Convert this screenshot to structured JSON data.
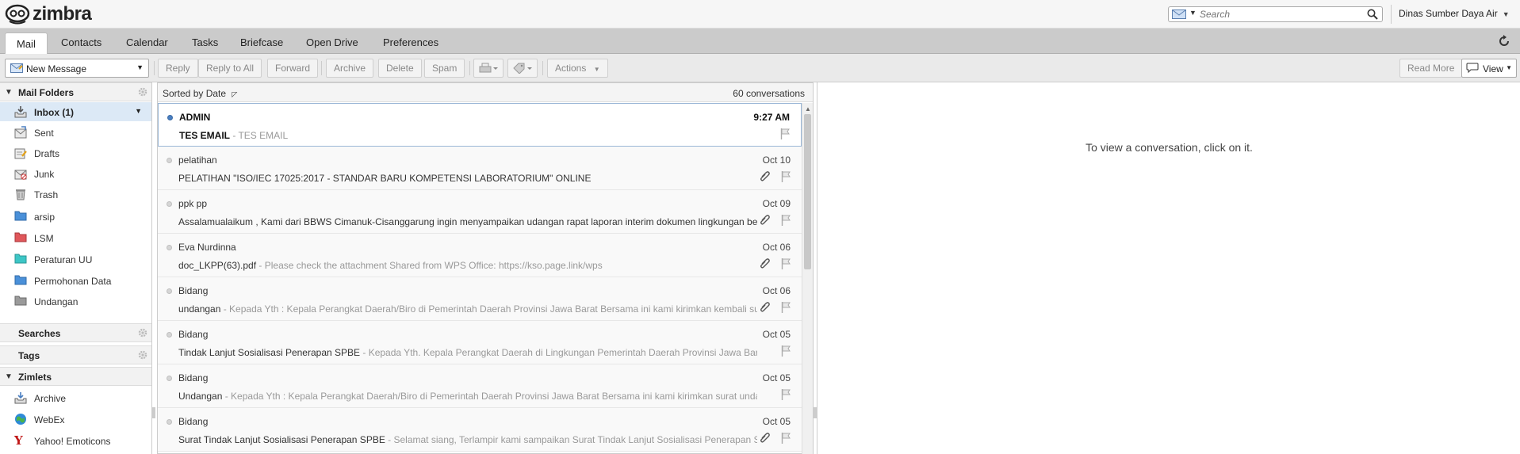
{
  "app": {
    "logo_text": "zimbra"
  },
  "search": {
    "placeholder": "Search"
  },
  "user": {
    "name": "Dinas Sumber Daya Air"
  },
  "tabs": [
    {
      "label": "Mail",
      "active": true
    },
    {
      "label": "Contacts"
    },
    {
      "label": "Calendar"
    },
    {
      "label": "Tasks"
    },
    {
      "label": "Briefcase"
    },
    {
      "label": "Open Drive"
    },
    {
      "label": "Preferences"
    }
  ],
  "toolbar": {
    "new_message": "New Message",
    "reply": "Reply",
    "reply_all": "Reply to All",
    "forward": "Forward",
    "archive": "Archive",
    "delete": "Delete",
    "spam": "Spam",
    "actions": "Actions",
    "read_more": "Read More",
    "view": "View"
  },
  "sidebar": {
    "mail_folders": "Mail Folders",
    "folders": [
      {
        "label": "Inbox (1)",
        "icon": "inbox-icon",
        "selected": true
      },
      {
        "label": "Sent",
        "icon": "sent-icon"
      },
      {
        "label": "Drafts",
        "icon": "drafts-icon"
      },
      {
        "label": "Junk",
        "icon": "junk-icon"
      },
      {
        "label": "Trash",
        "icon": "trash-icon"
      },
      {
        "label": "arsip",
        "icon": "folder-icon",
        "color": "#4a90d9"
      },
      {
        "label": "LSM",
        "icon": "folder-icon",
        "color": "#e0575b"
      },
      {
        "label": "Peraturan UU",
        "icon": "folder-icon",
        "color": "#3cc6c6"
      },
      {
        "label": "Permohonan Data",
        "icon": "folder-icon",
        "color": "#4a90d9"
      },
      {
        "label": "Undangan",
        "icon": "folder-icon",
        "color": "#9a9a9a"
      }
    ],
    "searches": "Searches",
    "tags": "Tags",
    "zimlets": "Zimlets",
    "zimlet_items": [
      {
        "label": "Archive",
        "icon": "archive-zimlet-icon"
      },
      {
        "label": "WebEx",
        "icon": "webex-icon"
      },
      {
        "label": "Yahoo! Emoticons",
        "icon": "yahoo-icon"
      }
    ]
  },
  "list": {
    "sorted_by": "Sorted by Date",
    "count": "60 conversations",
    "messages": [
      {
        "from": "ADMIN",
        "date": "9:27 AM",
        "subject": "TES EMAIL",
        "fragment": " - TES EMAIL",
        "unread": true,
        "attachment": false
      },
      {
        "from": "pelatihan",
        "date": "Oct 10",
        "subject": "PELATIHAN \"ISO/IEC 17025:2017 - STANDAR BARU KOMPETENSI LABORATORIUM\" ONLINE",
        "fragment": "",
        "attachment": true
      },
      {
        "from": "ppk pp",
        "date": "Oct 09",
        "subject": "Assalamualaikum , Kami dari BBWS Cimanuk-Cisanggarung ingin menyampaikan udangan rapat laporan interim dokumen lingkungan bendung",
        "fragment": "",
        "attachment": true
      },
      {
        "from": "Eva Nurdinna",
        "date": "Oct 06",
        "subject": "doc_LKPP(63).pdf",
        "fragment": " - Please check the attachment Shared from WPS Office: https://kso.page.link/wps",
        "attachment": true
      },
      {
        "from": "Bidang",
        "date": "Oct 06",
        "subject": "undangan",
        "fragment": " - Kepada Yth : Kepala Perangkat Daerah/Biro di Pemerintah Daerah Provinsi Jawa Barat Bersama ini kami kirimkan kembali surat undangan",
        "attachment": true
      },
      {
        "from": "Bidang",
        "date": "Oct 05",
        "subject": "Tindak Lanjut Sosialisasi Penerapan SPBE",
        "fragment": " - Kepada Yth. Kepala Perangkat Daerah di Lingkungan Pemerintah Daerah Provinsi Jawa Barat Terlampir",
        "attachment": false
      },
      {
        "from": "Bidang",
        "date": "Oct 05",
        "subject": "Undangan",
        "fragment": " - Kepada Yth : Kepala Perangkat Daerah/Biro di Pemerintah Daerah Provinsi Jawa Barat Bersama ini kami kirimkan surat undangan Webinar",
        "attachment": false
      },
      {
        "from": "Bidang",
        "date": "Oct 05",
        "subject": "Surat Tindak Lanjut Sosialisasi Penerapan SPBE",
        "fragment": " - Selamat siang, Terlampir kami sampaikan Surat Tindak Lanjut Sosialisasi Penerapan SPBE, mohon",
        "attachment": true
      }
    ]
  },
  "reading": {
    "empty_message": "To view a conversation, click on it."
  }
}
